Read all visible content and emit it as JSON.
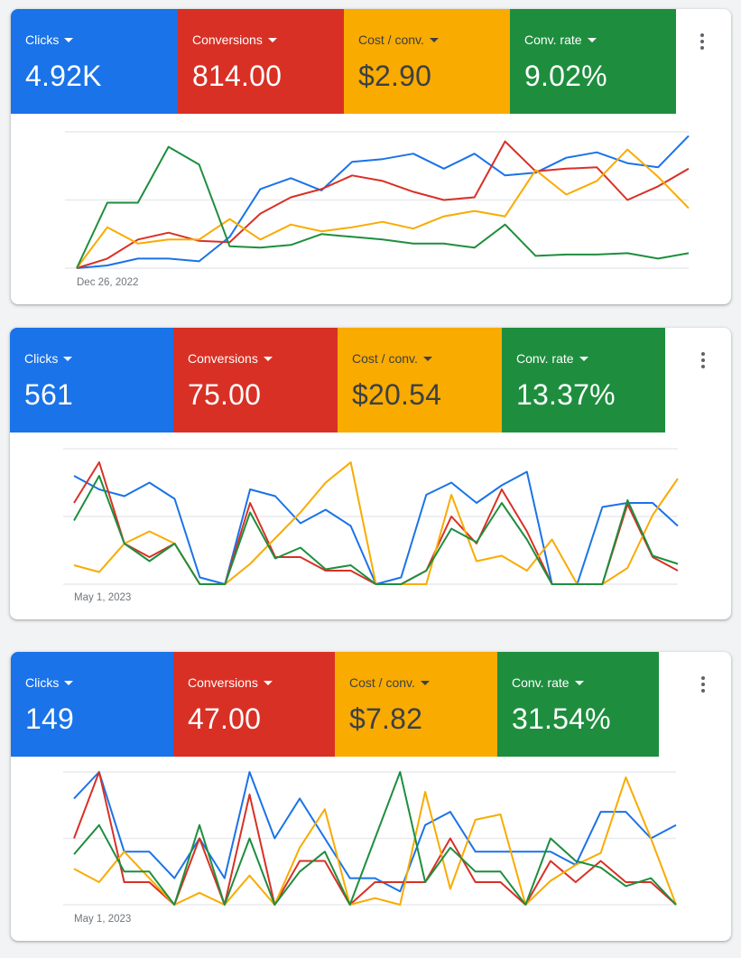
{
  "colors": {
    "blue": "#1a73e8",
    "red": "#d93025",
    "yellow": "#f9ab00",
    "green": "#1e8e3e",
    "gridline": "#e8eaed"
  },
  "cards": [
    {
      "metrics": [
        {
          "label": "Clicks",
          "value": "4.92K",
          "color": "blue"
        },
        {
          "label": "Conversions",
          "value": "814.00",
          "color": "red"
        },
        {
          "label": "Cost / conv.",
          "value": "$2.90",
          "color": "yellow"
        },
        {
          "label": "Conv. rate",
          "value": "9.02%",
          "color": "green"
        }
      ],
      "more_icon": "more-vert-icon",
      "start_date": "Dec 26, 2022"
    },
    {
      "metrics": [
        {
          "label": "Clicks",
          "value": "561",
          "color": "blue"
        },
        {
          "label": "Conversions",
          "value": "75.00",
          "color": "red"
        },
        {
          "label": "Cost / conv.",
          "value": "$20.54",
          "color": "yellow"
        },
        {
          "label": "Conv. rate",
          "value": "13.37%",
          "color": "green"
        }
      ],
      "more_icon": "more-vert-icon",
      "start_date": "May 1, 2023"
    },
    {
      "metrics": [
        {
          "label": "Clicks",
          "value": "149",
          "color": "blue"
        },
        {
          "label": "Conversions",
          "value": "47.00",
          "color": "red"
        },
        {
          "label": "Cost / conv.",
          "value": "$7.82",
          "color": "yellow"
        },
        {
          "label": "Conv. rate",
          "value": "31.54%",
          "color": "green"
        }
      ],
      "more_icon": "more-vert-icon",
      "start_date": "May 1, 2023"
    }
  ],
  "chart_data": [
    {
      "type": "line",
      "title": "",
      "xlabel": "",
      "ylabel": "",
      "x_start_label": "Dec 26, 2022",
      "ylim": [
        0,
        100
      ],
      "y_units": "percent of each series' axis max (axes unlabeled)",
      "grid": true,
      "gridlines": 3,
      "points": 21,
      "series": [
        {
          "name": "Clicks",
          "color": "blue",
          "values": [
            0,
            2,
            7,
            7,
            5,
            23,
            58,
            66,
            57,
            78,
            80,
            84,
            73,
            84,
            68,
            70,
            81,
            85,
            77,
            74,
            97
          ]
        },
        {
          "name": "Conversions",
          "color": "red",
          "values": [
            0,
            7,
            21,
            26,
            20,
            19,
            40,
            52,
            58,
            68,
            64,
            56,
            50,
            52,
            93,
            71,
            73,
            74,
            50,
            60,
            73
          ]
        },
        {
          "name": "Cost / conv.",
          "color": "yellow",
          "values": [
            0,
            30,
            18,
            21,
            21,
            36,
            21,
            32,
            27,
            30,
            34,
            29,
            38,
            42,
            38,
            72,
            54,
            64,
            87,
            67,
            44
          ]
        },
        {
          "name": "Conv. rate",
          "color": "green",
          "values": [
            0,
            48,
            48,
            89,
            76,
            16,
            15,
            17,
            25,
            23,
            21,
            18,
            18,
            15,
            32,
            9,
            10,
            10,
            11,
            7,
            11
          ]
        }
      ]
    },
    {
      "type": "line",
      "title": "",
      "xlabel": "",
      "ylabel": "",
      "x_start_label": "May 1, 2023",
      "ylim": [
        0,
        100
      ],
      "y_units": "percent of each series' axis max (axes unlabeled)",
      "grid": true,
      "gridlines": 3,
      "points": 25,
      "series": [
        {
          "name": "Clicks",
          "color": "blue",
          "values": [
            80,
            70,
            65,
            75,
            63,
            5,
            0,
            70,
            65,
            45,
            55,
            43,
            0,
            5,
            66,
            75,
            60,
            73,
            83,
            0,
            0,
            57,
            60,
            60,
            43
          ]
        },
        {
          "name": "Conversions",
          "color": "red",
          "values": [
            60,
            90,
            30,
            20,
            30,
            0,
            0,
            60,
            20,
            20,
            10,
            10,
            0,
            0,
            10,
            50,
            30,
            70,
            39,
            0,
            0,
            0,
            59,
            20,
            10
          ]
        },
        {
          "name": "Cost / conv.",
          "color": "yellow",
          "values": [
            14,
            9,
            30,
            39,
            30,
            0,
            0,
            15,
            34,
            53,
            75,
            90,
            0,
            0,
            0,
            66,
            17,
            21,
            10,
            33,
            0,
            0,
            12,
            51,
            78
          ]
        },
        {
          "name": "Conv. rate",
          "color": "green",
          "values": [
            47,
            80,
            30,
            17,
            30,
            0,
            0,
            53,
            19,
            27,
            11,
            14,
            0,
            0,
            10,
            41,
            31,
            60,
            33,
            0,
            0,
            0,
            62,
            21,
            15
          ]
        }
      ]
    },
    {
      "type": "line",
      "title": "",
      "xlabel": "",
      "ylabel": "",
      "x_start_label": "May 1, 2023",
      "ylim": [
        0,
        100
      ],
      "y_units": "percent of each series' axis max (axes unlabeled)",
      "grid": true,
      "gridlines": 3,
      "points": 25,
      "series": [
        {
          "name": "Clicks",
          "color": "blue",
          "values": [
            80,
            100,
            40,
            40,
            20,
            50,
            20,
            100,
            50,
            80,
            50,
            20,
            20,
            10,
            60,
            70,
            40,
            40,
            40,
            40,
            30,
            70,
            70,
            50,
            60
          ]
        },
        {
          "name": "Conversions",
          "color": "red",
          "values": [
            50,
            100,
            17,
            17,
            0,
            50,
            0,
            83,
            0,
            33,
            33,
            0,
            17,
            17,
            17,
            50,
            17,
            17,
            0,
            33,
            17,
            33,
            17,
            17,
            0
          ]
        },
        {
          "name": "Cost / conv.",
          "color": "yellow",
          "values": [
            27,
            17,
            40,
            20,
            0,
            9,
            0,
            22,
            0,
            43,
            72,
            0,
            5,
            0,
            85,
            12,
            64,
            68,
            0,
            18,
            30,
            39,
            96,
            50,
            0
          ]
        },
        {
          "name": "Conv. rate",
          "color": "green",
          "values": [
            38,
            60,
            25,
            25,
            0,
            60,
            0,
            50,
            0,
            25,
            40,
            0,
            50,
            100,
            17,
            43,
            25,
            25,
            0,
            50,
            33,
            28,
            14,
            20,
            0
          ]
        }
      ]
    }
  ]
}
